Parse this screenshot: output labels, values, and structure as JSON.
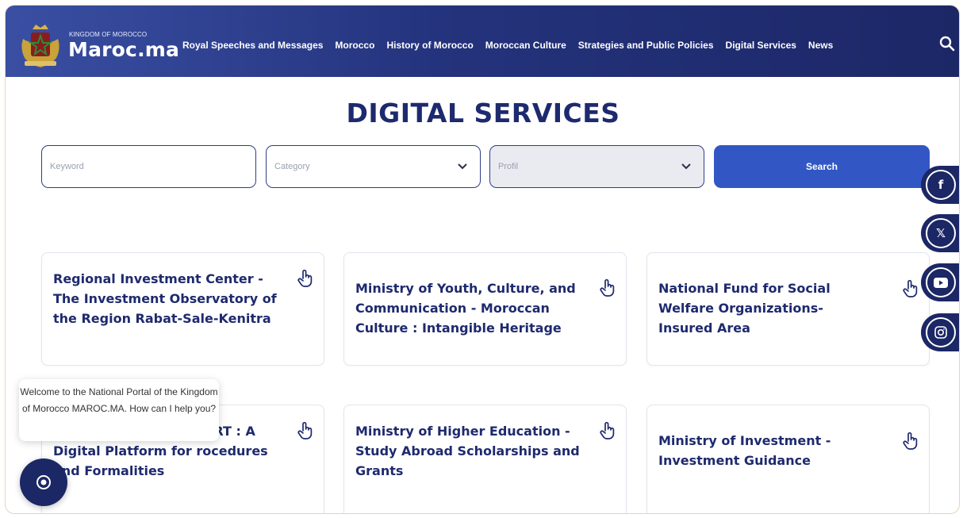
{
  "header": {
    "brand_small": "KINGDOM OF MOROCCO",
    "brand_big": "Maroc.ma",
    "logo_icon": "coat-of-arms-logo",
    "nav": [
      "Royal Speeches and Messages",
      "Morocco",
      "History of Morocco",
      "Moroccan Culture",
      "Strategies and Public Policies",
      "Digital Services",
      "News"
    ],
    "search_icon": "search-icon"
  },
  "page": {
    "title": "DIGITAL SERVICES"
  },
  "filters": {
    "keyword_placeholder": "Keyword",
    "category_label": "Category",
    "profil_label": "Profil",
    "search_button": "Search"
  },
  "cards": [
    {
      "title": "Regional Investment Center - The Investment Observatory of the Region Rabat-Sale-Kenitra"
    },
    {
      "title": "Ministry of Youth, Culture, and Communication - Moroccan Culture : Intangible Heritage"
    },
    {
      "title": "National Fund for Social Welfare Organizations- Insured Area"
    },
    {
      "title": "ART : A Digital Platform for rocedures and Formalities"
    },
    {
      "title": "Ministry of Higher Education - Study Abroad Scholarships and Grants"
    },
    {
      "title": "Ministry of Investment - Investment Guidance"
    }
  ],
  "social": [
    "facebook-icon",
    "x-icon",
    "youtube-icon",
    "instagram-icon"
  ],
  "chat": {
    "message": "Welcome to the National Portal of the Kingdom of Morocco MAROC.MA. How can I help you?"
  },
  "colors": {
    "primary_dark": "#1c2766",
    "title_blue": "#1e2a6e",
    "button_blue": "#3257c4",
    "header_gradient_start": "#3a4fa3"
  }
}
